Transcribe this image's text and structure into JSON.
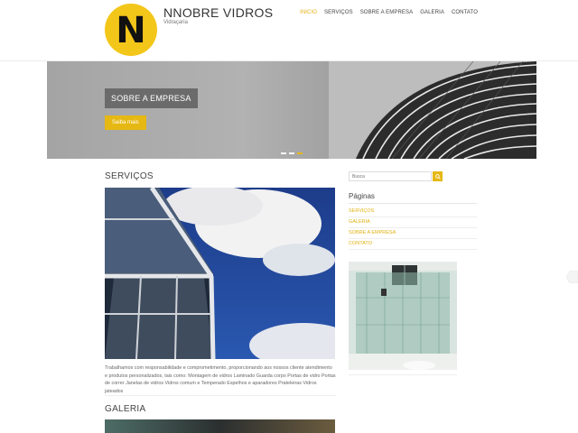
{
  "header": {
    "logo_letter": "N",
    "site_title": "NNOBRE VIDROS",
    "tagline": "Vidraçaria",
    "nav": [
      {
        "label": "INICIO",
        "active": true
      },
      {
        "label": "SERVIÇOS",
        "active": false
      },
      {
        "label": "SOBRE A EMPRESA",
        "active": false
      },
      {
        "label": "GALERIA",
        "active": false
      },
      {
        "label": "CONTATO",
        "active": false
      }
    ]
  },
  "slider": {
    "title": "SOBRE A EMPRESA",
    "button_label": "Saiba mais",
    "dots": 3,
    "active_dot": 3
  },
  "main": {
    "services_title": "SERVIÇOS",
    "services_text": "Trabalhamos com responsabilidade e comprometimento, proporcionando aos nossos cliente atendimento e produtos personalizados, tais como: Montagem de vidros Laminado Guarda corpo Portas de vidro Portas de correr Janelas de vidros Vidros comum e Temperado Espelhos e aparadores Prateleiras Vidros jateados",
    "gallery_title": "GALERIA"
  },
  "sidebar": {
    "search_placeholder": "Busca",
    "pages_title": "Páginas",
    "pages": [
      "SERVIÇOS",
      "GALERIA",
      "SOBRE A EMPRESA",
      "CONTATO"
    ]
  },
  "colors": {
    "accent": "#e6b813",
    "logo": "#f3c61a"
  }
}
